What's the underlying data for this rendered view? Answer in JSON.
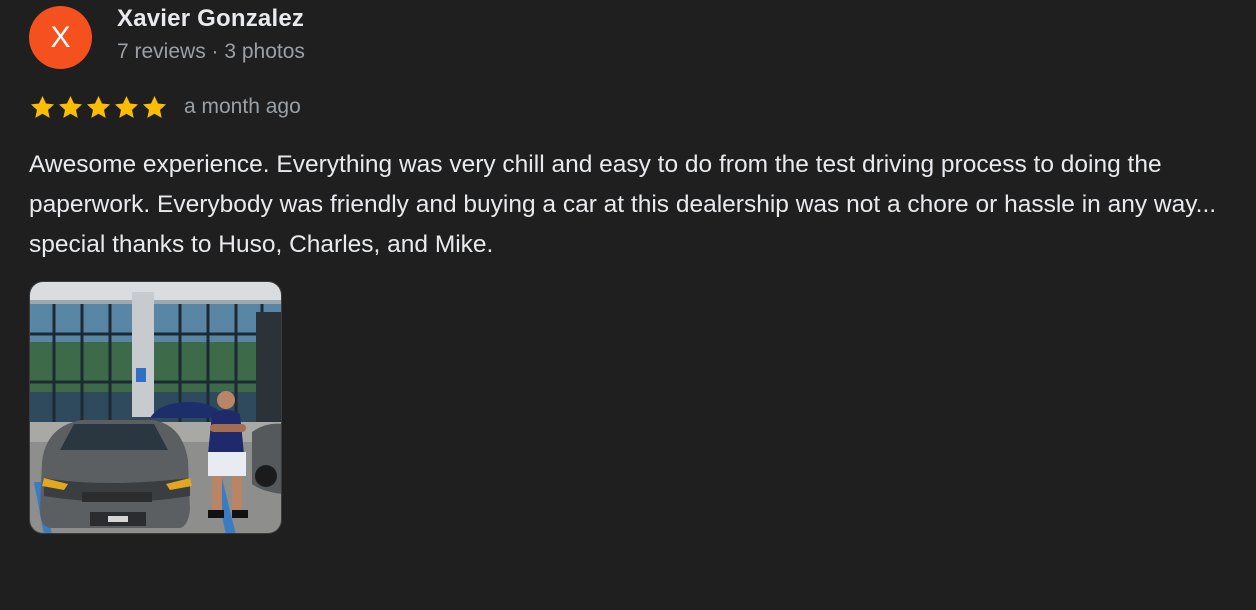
{
  "author": {
    "initial": "X",
    "name": "Xavier Gonzalez",
    "meta": "7 reviews · 3 photos",
    "avatar_color": "#f4511e"
  },
  "rating": {
    "stars": 5,
    "max": 5,
    "star_color": "#fbbc04"
  },
  "time": "a month ago",
  "text": "Awesome experience. Everything was very chill and easy to do from the test driving process to doing the paperwork. Everybody was friendly and buying a car at this dealership was not a chore or hassle in any way... special thanks to Huso, Charles, and Mike.",
  "photos": [
    {
      "icon": "review-photo"
    }
  ]
}
